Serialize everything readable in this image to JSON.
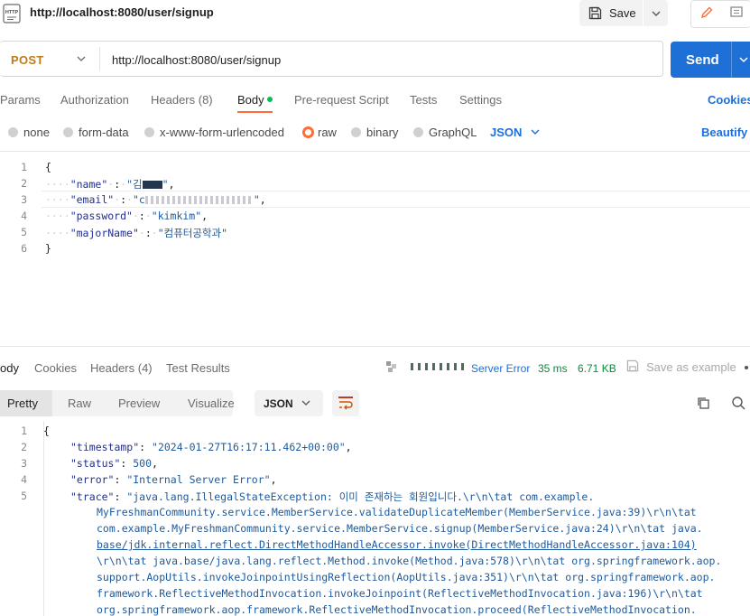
{
  "window": {
    "title": "http://localhost:8080/user/signup"
  },
  "toolbar": {
    "save_label": "Save"
  },
  "request": {
    "method": "POST",
    "url": "http://localhost:8080/user/signup",
    "send_label": "Send"
  },
  "tabs": {
    "params": "Params",
    "authorization": "Authorization",
    "headers": "Headers (8)",
    "body": "Body",
    "prerequest": "Pre-request Script",
    "tests": "Tests",
    "settings": "Settings",
    "cookies": "Cookies"
  },
  "body_types": {
    "none": "none",
    "form_data": "form-data",
    "urlencoded": "x-www-form-urlencoded",
    "raw": "raw",
    "binary": "binary",
    "graphql": "GraphQL",
    "format": "JSON",
    "beautify": "Beautify"
  },
  "request_body": {
    "line_numbers": [
      "1",
      "2",
      "3",
      "4",
      "5",
      "6"
    ],
    "open": "{",
    "close": "}",
    "name_key": "\"name\"",
    "name_val": "\"김",
    "email_key": "\"email\"",
    "email_val": "\"c",
    "password_key": "\"password\"",
    "password_val": "\"kimkim\"",
    "major_key": "\"majorName\"",
    "major_val": "\"컴퓨터공학과\""
  },
  "response_tabs": {
    "body": "ody",
    "cookies": "Cookies",
    "headers": "Headers (4)",
    "test_results": "Test Results",
    "status": "Server Error",
    "time": "35 ms",
    "size": "6.71 KB",
    "save_example": "Save as example"
  },
  "response_view": {
    "pretty": "Pretty",
    "raw": "Raw",
    "preview": "Preview",
    "visualize": "Visualize",
    "format": "JSON"
  },
  "response_body": {
    "line_numbers": [
      "1",
      "2",
      "3",
      "4",
      "5"
    ],
    "open": "{",
    "timestamp_key": "\"timestamp\"",
    "timestamp_val": "\"2024-01-27T16:17:11.462+00:00\"",
    "status_key": "\"status\"",
    "status_val": "500",
    "error_key": "\"error\"",
    "error_val": "\"Internal Server Error\"",
    "trace_key": "\"trace\"",
    "trace_lines": [
      "\"java.lang.IllegalStateException: 이미 존재하는 회원입니다.\\r\\n\\tat com.example.",
      "MyFreshmanCommunity.service.MemberService.validateDuplicateMember(MemberService.java:39)\\r\\n\\tat",
      "com.example.MyFreshmanCommunity.service.MemberService.signup(MemberService.java:24)\\r\\n\\tat java.",
      "base/jdk.internal.reflect.DirectMethodHandleAccessor.invoke(DirectMethodHandleAccessor.java:104)",
      "\\r\\n\\tat java.base/java.lang.reflect.Method.invoke(Method.java:578)\\r\\n\\tat org.springframework.aop.",
      "support.AopUtils.invokeJoinpointUsingReflection(AopUtils.java:351)\\r\\n\\tat org.springframework.aop.",
      "framework.ReflectiveMethodInvocation.invokeJoinpoint(ReflectiveMethodInvocation.java:196)\\r\\n\\tat",
      "org.springframework.aop.framework.ReflectiveMethodInvocation.proceed(ReflectiveMethodInvocation."
    ]
  },
  "colors": {
    "accent": "#ff6c37",
    "send": "#1e6fd6",
    "method": "#c27a14",
    "status_error": "#1e6fd6"
  }
}
